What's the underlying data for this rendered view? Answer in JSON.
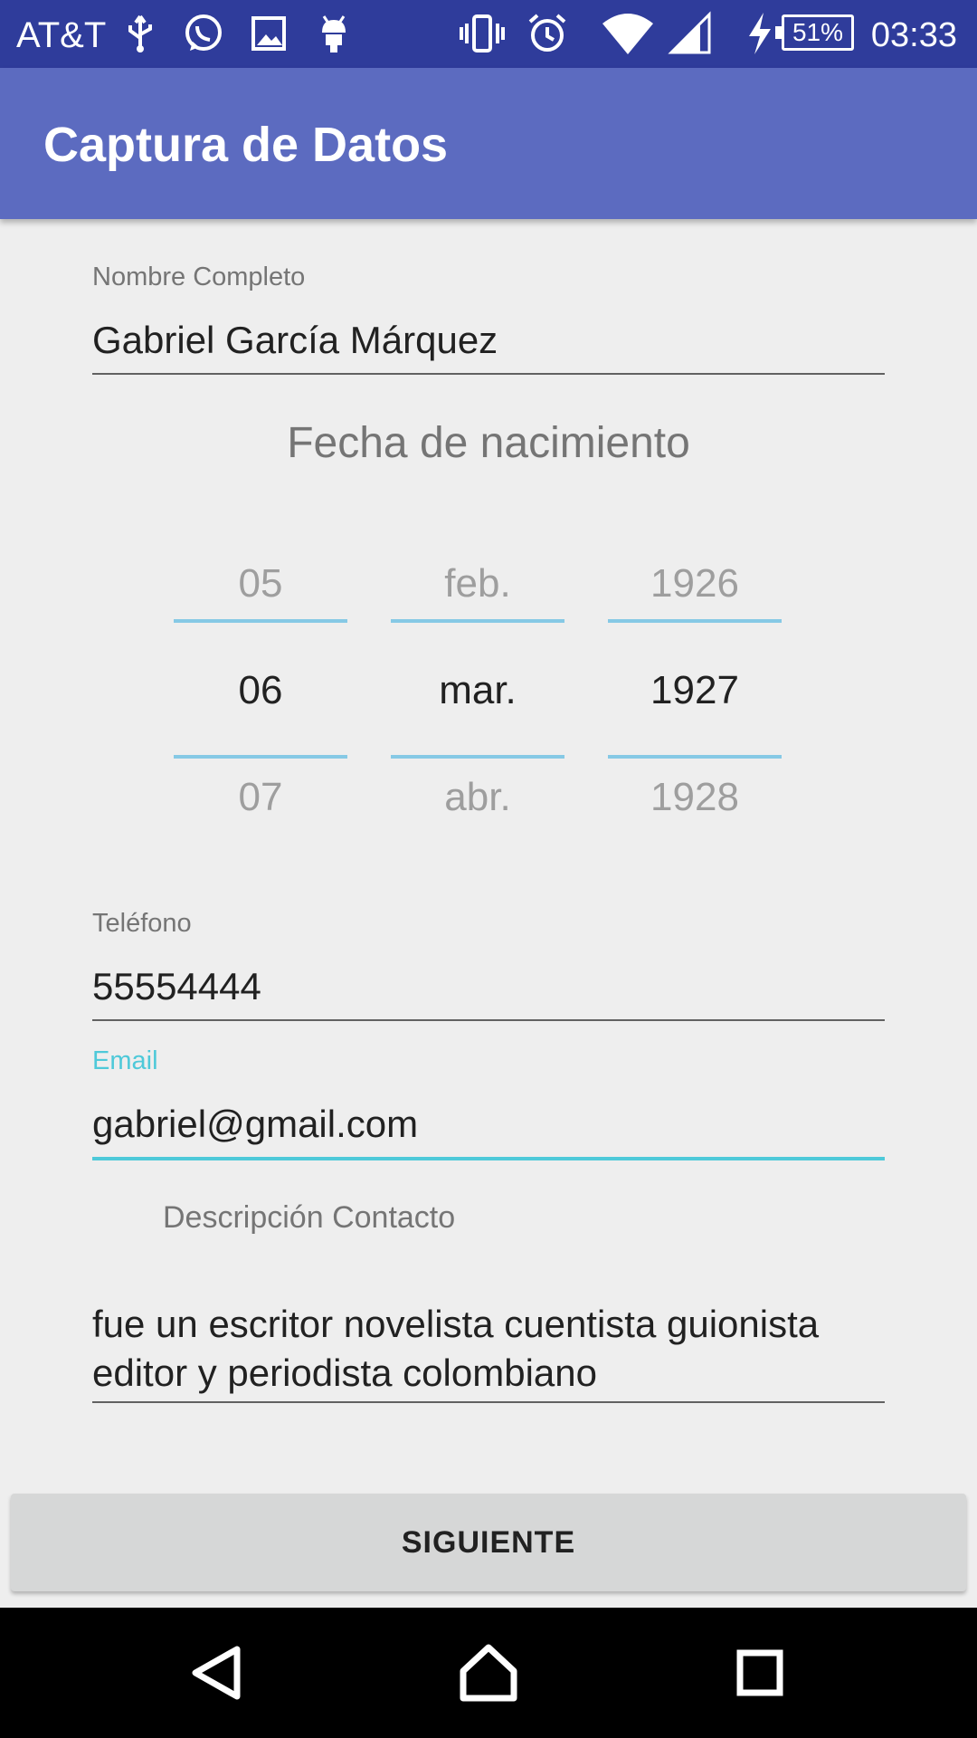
{
  "status_bar": {
    "carrier": "AT&T",
    "battery": "51%",
    "time": "03:33",
    "icons": [
      "usb-icon",
      "whatsapp-icon",
      "image-icon",
      "android-icon",
      "vibrate-icon",
      "alarm-icon",
      "wifi-icon",
      "signal-icon",
      "charging-icon"
    ]
  },
  "app_bar": {
    "title": "Captura de Datos"
  },
  "form": {
    "name_label": "Nombre Completo",
    "name_value": "Gabriel García Márquez",
    "dob_title": "Fecha de nacimiento",
    "day": {
      "prev": "05",
      "selected": "06",
      "next": "07"
    },
    "month": {
      "prev": "feb.",
      "selected": "mar.",
      "next": "abr."
    },
    "year": {
      "prev": "1926",
      "selected": "1927",
      "next": "1928"
    },
    "phone_label": "Teléfono",
    "phone_value": "55554444",
    "email_label": "Email",
    "email_value": "gabriel@gmail.com",
    "desc_label": "Descripción Contacto",
    "desc_value": "fue un escritor novelista cuentista guionista editor y periodista colombiano"
  },
  "button": {
    "next_label": "SIGUIENTE"
  },
  "colors": {
    "status_bar": "#2f3c9b",
    "app_bar": "#5c6bc0",
    "accent": "#4ec9d9",
    "picker_line": "#86c9e5"
  }
}
